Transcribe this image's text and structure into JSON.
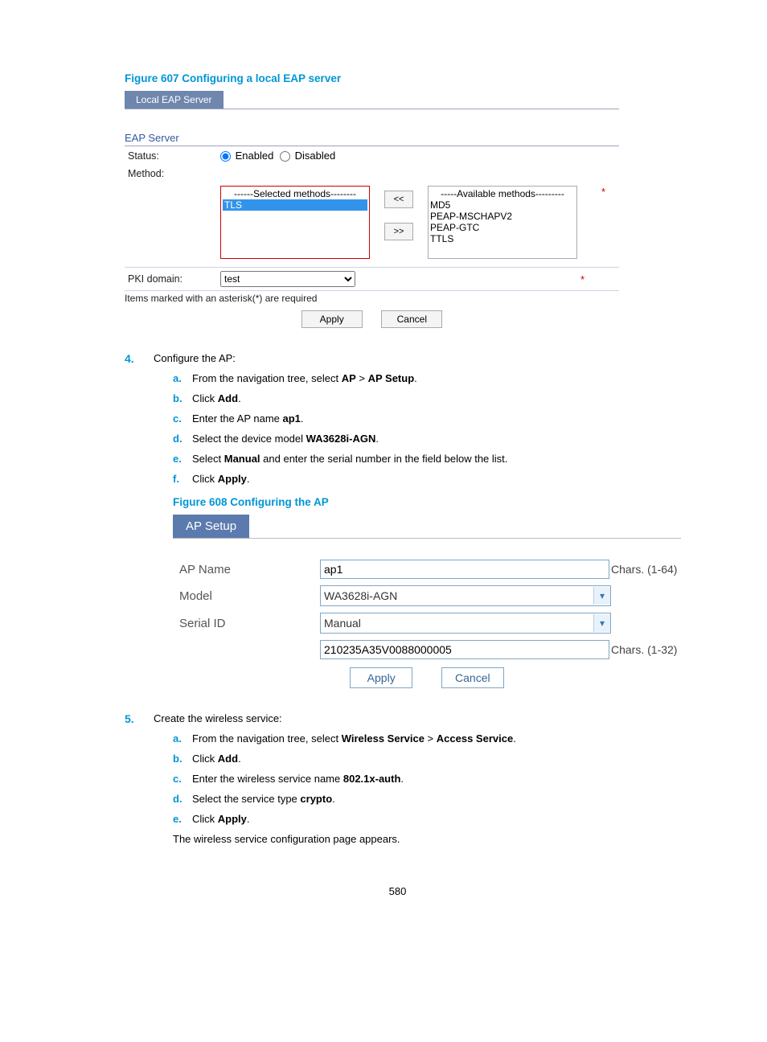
{
  "figure607": {
    "title": "Figure 607 Configuring a local EAP server",
    "tab": "Local EAP Server",
    "section": "EAP Server",
    "status_label": "Status:",
    "enabled_label": "Enabled",
    "disabled_label": "Disabled",
    "method_label": "Method:",
    "selected_header": "------Selected methods--------",
    "selected_item": "TLS",
    "available_header": "-----Available methods---------",
    "available": [
      "MD5",
      "PEAP-MSCHAPV2",
      "PEAP-GTC",
      "TTLS"
    ],
    "move_left": "<<",
    "move_right": ">>",
    "pki_label": "PKI domain:",
    "pki_value": "test",
    "note": "Items marked with an asterisk(*) are required",
    "apply": "Apply",
    "cancel": "Cancel"
  },
  "step4": {
    "num": "4.",
    "intro": "Configure the AP:",
    "a": {
      "n": "a.",
      "pre": "From the navigation tree, select ",
      "b1": "AP",
      "mid": " > ",
      "b2": "AP Setup",
      "post": "."
    },
    "b": {
      "n": "b.",
      "pre": "Click ",
      "b1": "Add",
      "post": "."
    },
    "c": {
      "n": "c.",
      "pre": "Enter the AP name ",
      "b1": "ap1",
      "post": "."
    },
    "d": {
      "n": "d.",
      "pre": "Select the device model ",
      "b1": "WA3628i-AGN",
      "post": "."
    },
    "e": {
      "n": "e.",
      "pre": "Select ",
      "b1": "Manual",
      "post": " and enter the serial number in the field below the list."
    },
    "f": {
      "n": "f.",
      "pre": "Click ",
      "b1": "Apply",
      "post": "."
    }
  },
  "figure608": {
    "title": "Figure 608 Configuring the AP",
    "tab": "AP Setup",
    "apname_label": "AP Name",
    "apname_value": "ap1",
    "apname_hint": "Chars. (1-64)",
    "model_label": "Model",
    "model_value": "WA3628i-AGN",
    "serial_label": "Serial ID",
    "serial_value": "Manual",
    "serial_input": "210235A35V0088000005",
    "serial_hint": "Chars. (1-32)",
    "apply": "Apply",
    "cancel": "Cancel"
  },
  "step5": {
    "num": "5.",
    "intro": "Create the wireless service:",
    "a": {
      "n": "a.",
      "pre": "From the navigation tree, select ",
      "b1": "Wireless Service",
      "mid": " > ",
      "b2": "Access Service",
      "post": "."
    },
    "b": {
      "n": "b.",
      "pre": "Click ",
      "b1": "Add",
      "post": "."
    },
    "c": {
      "n": "c.",
      "pre": "Enter the wireless service name ",
      "b1": "802.1x-auth",
      "post": "."
    },
    "d": {
      "n": "d.",
      "pre": "Select the service type ",
      "b1": "crypto",
      "post": "."
    },
    "e": {
      "n": "e.",
      "pre": "Click ",
      "b1": "Apply",
      "post": "."
    },
    "extra": "The wireless service configuration page appears."
  },
  "pageno": "580",
  "star": "*"
}
